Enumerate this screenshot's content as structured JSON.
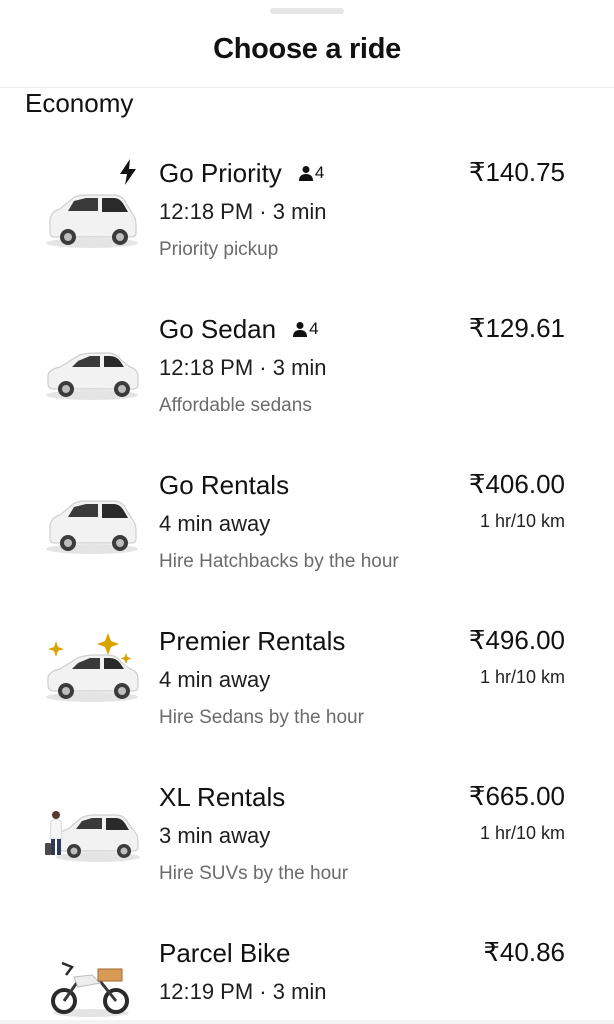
{
  "header": {
    "title": "Choose a ride"
  },
  "section": {
    "title": "Economy"
  },
  "rides": [
    {
      "name": "Go Priority",
      "capacity": "4",
      "eta": "12:18 PM · 3 min",
      "description": "Priority pickup",
      "price": "₹140.75",
      "price_sub": "",
      "icon": "hatchback-car-icon",
      "badge_icon": "lightning-bolt-icon"
    },
    {
      "name": "Go Sedan",
      "capacity": "4",
      "eta": "12:18 PM · 3 min",
      "description": "Affordable sedans",
      "price": "₹129.61",
      "price_sub": "",
      "icon": "sedan-car-icon"
    },
    {
      "name": "Go Rentals",
      "capacity": "",
      "eta": "4 min away",
      "description": "Hire Hatchbacks by the hour",
      "price": "₹406.00",
      "price_sub": "1 hr/10 km",
      "icon": "hatchback-car-icon"
    },
    {
      "name": "Premier Rentals",
      "capacity": "",
      "eta": "4 min away",
      "description": "Hire Sedans by the hour",
      "price": "₹496.00",
      "price_sub": "1 hr/10 km",
      "icon": "premier-sedan-sparkle-icon"
    },
    {
      "name": "XL Rentals",
      "capacity": "",
      "eta": "3 min away",
      "description": "Hire SUVs by the hour",
      "price": "₹665.00",
      "price_sub": "1 hr/10 km",
      "icon": "suv-with-driver-icon"
    },
    {
      "name": "Parcel Bike",
      "capacity": "",
      "eta": "12:19 PM · 3 min",
      "description": "",
      "price": "₹40.86",
      "price_sub": "",
      "icon": "parcel-bike-icon"
    }
  ],
  "colors": {
    "text": "#111111",
    "muted": "#6b6b6b",
    "divider": "#ececec",
    "sparkle": "#d9a400"
  }
}
